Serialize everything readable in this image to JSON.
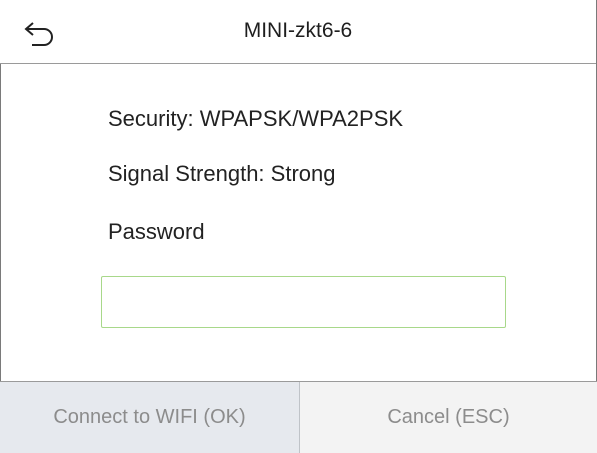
{
  "header": {
    "title": "MINI-zkt6-6",
    "back_icon": "back-arrow-icon"
  },
  "info": {
    "security": "Security: WPAPSK/WPA2PSK",
    "signal": "Signal Strength: Strong",
    "password_label": "Password"
  },
  "password_field": {
    "value": "",
    "placeholder": "",
    "border_color": "#a8d88a"
  },
  "footer": {
    "connect_label": "Connect to WIFI (OK)",
    "cancel_label": "Cancel (ESC)"
  },
  "colors": {
    "button_text": "#8c8c8c",
    "connect_bg": "#e6e9ee",
    "cancel_bg": "#f3f3f3"
  }
}
